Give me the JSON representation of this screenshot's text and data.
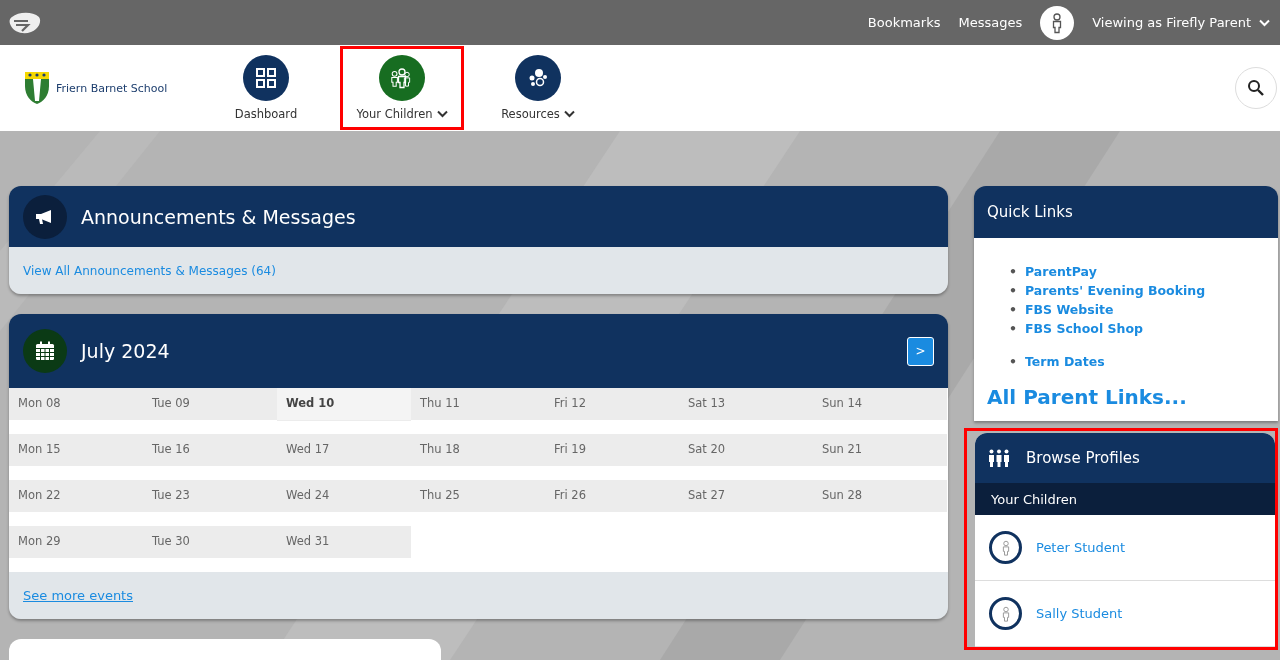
{
  "top_bar": {
    "links": [
      "Bookmarks",
      "Messages"
    ],
    "account": "Viewing as Firefly Parent"
  },
  "school": {
    "name": "Friern Barnet School"
  },
  "nav": [
    {
      "label": "Dashboard",
      "kind": "dashboard",
      "dropdown": false,
      "highlighted": false
    },
    {
      "label": "Your Children",
      "kind": "children",
      "dropdown": true,
      "highlighted": true
    },
    {
      "label": "Resources",
      "kind": "resources",
      "dropdown": true,
      "highlighted": false
    }
  ],
  "announcements": {
    "title": "Announcements & Messages",
    "link": "View All Announcements & Messages (64)"
  },
  "calendar": {
    "title": "July 2024",
    "next": ">",
    "footer_link": "See more events",
    "weeks": [
      [
        {
          "label": "Mon 08",
          "today": false
        },
        {
          "label": "Tue 09",
          "today": false
        },
        {
          "label": "Wed 10",
          "today": true
        },
        {
          "label": "Thu 11",
          "today": false
        },
        {
          "label": "Fri 12",
          "today": false
        },
        {
          "label": "Sat 13",
          "today": false
        },
        {
          "label": "Sun 14",
          "today": false
        }
      ],
      [
        {
          "label": "Mon 15",
          "today": false
        },
        {
          "label": "Tue 16",
          "today": false
        },
        {
          "label": "Wed 17",
          "today": false
        },
        {
          "label": "Thu 18",
          "today": false
        },
        {
          "label": "Fri 19",
          "today": false
        },
        {
          "label": "Sat 20",
          "today": false
        },
        {
          "label": "Sun 21",
          "today": false
        }
      ],
      [
        {
          "label": "Mon 22",
          "today": false
        },
        {
          "label": "Tue 23",
          "today": false
        },
        {
          "label": "Wed 24",
          "today": false
        },
        {
          "label": "Thu 25",
          "today": false
        },
        {
          "label": "Fri 26",
          "today": false
        },
        {
          "label": "Sat 27",
          "today": false
        },
        {
          "label": "Sun 28",
          "today": false
        }
      ],
      [
        {
          "label": "Mon 29",
          "today": false
        },
        {
          "label": "Tue 30",
          "today": false
        },
        {
          "label": "Wed 31",
          "today": false
        }
      ]
    ]
  },
  "quick_links": {
    "title": "Quick Links",
    "groups": [
      [
        {
          "marker": "•",
          "label": "ParentPay"
        },
        {
          "marker": "•",
          "label": "Parents' Evening Booking"
        },
        {
          "marker": "•",
          "label": "FBS Website"
        },
        {
          "marker": "•",
          "label": "FBS School Shop"
        }
      ],
      [
        {
          "marker": "•",
          "label": "Term Dates"
        }
      ]
    ],
    "all_link": "All Parent Links..."
  },
  "browse_profiles": {
    "title": "Browse Profiles",
    "highlighted": true,
    "section": "Your Children",
    "profiles": [
      "Peter Student",
      "Sally Student"
    ]
  }
}
